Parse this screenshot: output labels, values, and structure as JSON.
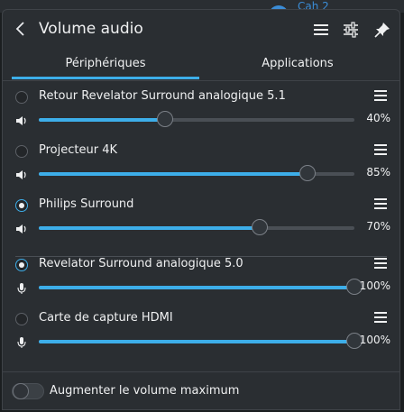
{
  "background": {
    "partial_text": "Cah 2"
  },
  "header": {
    "title": "Volume audio",
    "back_icon": "chevron-left-icon",
    "menu_icon": "hamburger-menu-icon",
    "settings_icon": "mixer-settings-icon",
    "pin_icon": "pin-icon"
  },
  "tabs": [
    {
      "label": "Périphériques",
      "active": true
    },
    {
      "label": "Applications",
      "active": false
    }
  ],
  "devices": [
    {
      "name": "Retour Revelator Surround analogique 5.1",
      "selected": false,
      "volume": 40,
      "volume_label": "40%",
      "icon": "speaker-icon"
    },
    {
      "name": "Projecteur 4K",
      "selected": false,
      "volume": 85,
      "volume_label": "85%",
      "icon": "speaker-icon"
    },
    {
      "name": "Philips Surround",
      "selected": true,
      "volume": 70,
      "volume_label": "70%",
      "icon": "speaker-icon"
    },
    {
      "name": "Revelator Surround analogique 5.0",
      "selected": true,
      "volume": 100,
      "volume_label": "100%",
      "icon": "microphone-icon"
    },
    {
      "name": "Carte de capture HDMI",
      "selected": false,
      "volume": 100,
      "volume_label": "100%",
      "icon": "microphone-icon"
    }
  ],
  "footer": {
    "raise_max_label": "Augmenter le volume maximum",
    "raise_max_enabled": false
  },
  "colors": {
    "accent": "#3daee9",
    "background": "#2a2e32",
    "text": "#eff0f1"
  }
}
